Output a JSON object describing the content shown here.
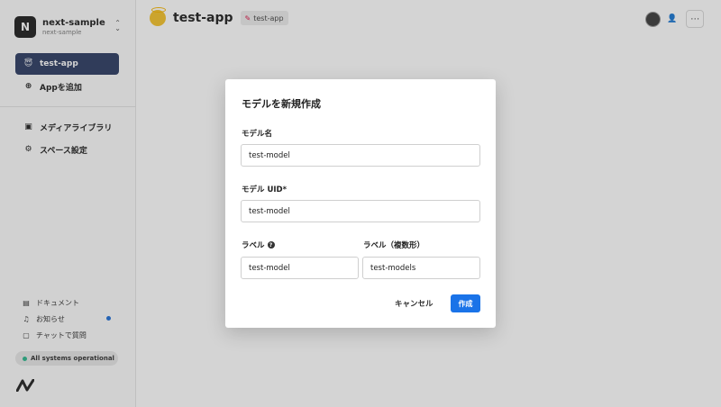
{
  "sidebar": {
    "space": {
      "initial": "N",
      "name": "next-sample",
      "sub": "next-sample"
    },
    "nav": [
      {
        "label": "test-app",
        "icon": "app-emoji-icon"
      },
      {
        "label": "Appを追加",
        "icon": "plus-circle-icon"
      },
      {
        "label": "メディアライブラリ",
        "icon": "image-icon"
      },
      {
        "label": "スペース設定",
        "icon": "gear-icon"
      }
    ],
    "bottom": [
      {
        "label": "ドキュメント",
        "icon": "book-icon"
      },
      {
        "label": "お知らせ",
        "icon": "bell-icon"
      },
      {
        "label": "チャットで質問",
        "icon": "chat-icon"
      }
    ],
    "status": "All systems operational"
  },
  "header": {
    "title": "test-app",
    "badge": "test-app"
  },
  "modal": {
    "title": "モデルを新規作成",
    "fields": {
      "name": {
        "label": "モデル名",
        "value": "test-model"
      },
      "uid": {
        "label": "モデル UID*",
        "value": "test-model"
      },
      "label_singular": {
        "label": "ラベル",
        "value": "test-model"
      },
      "label_plural": {
        "label": "ラベル（複数形）",
        "value": "test-models"
      }
    },
    "cancel": "キャンセル",
    "submit": "作成"
  },
  "colors": {
    "accent": "#1a73e8",
    "active_nav": "#2d3d63",
    "status_ok": "#2bb68c"
  }
}
